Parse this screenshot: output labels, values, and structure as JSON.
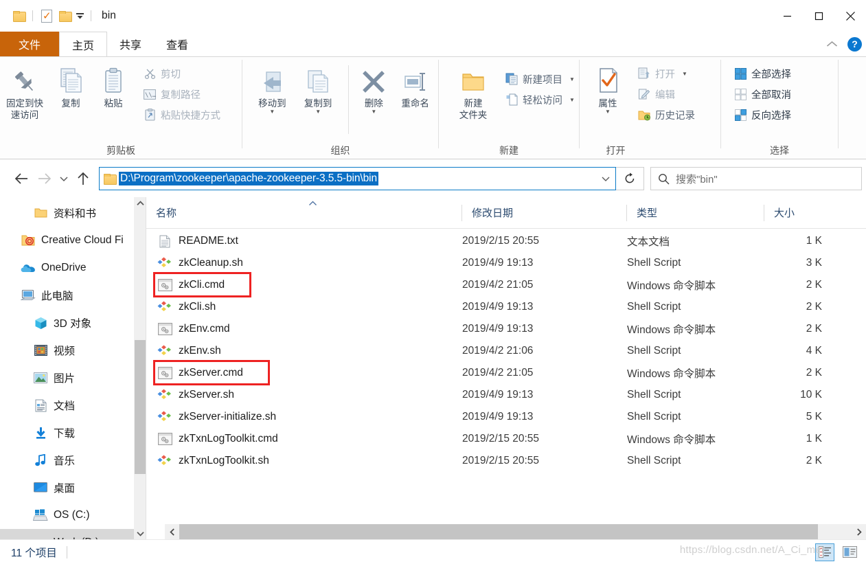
{
  "window": {
    "title": "bin",
    "quick_access": {
      "folder_icon": "folder-icon",
      "properties_icon": "properties-check-icon",
      "newfolder_icon": "new-folder-icon",
      "customize_caret": "chevron-down-icon"
    },
    "controls": {
      "minimize": "minimize-icon",
      "maximize": "maximize-icon",
      "close": "close-icon"
    }
  },
  "tabs": {
    "file": "文件",
    "items": [
      {
        "label": "主页",
        "active": true
      },
      {
        "label": "共享",
        "active": false
      },
      {
        "label": "查看",
        "active": false
      }
    ],
    "collapse_icon": "chevron-up-icon",
    "help": "?"
  },
  "ribbon": {
    "groups": [
      {
        "name": "clipboard",
        "label": "剪贴板",
        "big": [
          {
            "label": "固定到快\n速访问",
            "icon": "pin-icon"
          },
          {
            "label": "复制",
            "icon": "copy-icon"
          },
          {
            "label": "粘贴",
            "icon": "paste-icon"
          }
        ],
        "small": [
          {
            "label": "剪切",
            "icon": "scissors-icon",
            "dim": true
          },
          {
            "label": "复制路径",
            "icon": "copy-path-icon",
            "dim": true
          },
          {
            "label": "粘贴快捷方式",
            "icon": "paste-shortcut-icon",
            "dim": true
          }
        ]
      },
      {
        "name": "organize",
        "label": "组织",
        "big": [
          {
            "label": "移动到",
            "icon": "move-to-icon",
            "dropdown": true
          },
          {
            "label": "复制到",
            "icon": "copy-to-icon",
            "dropdown": true
          },
          {
            "label": "删除",
            "icon": "delete-x-icon",
            "dropdown": true
          },
          {
            "label": "重命名",
            "icon": "rename-icon"
          }
        ]
      },
      {
        "name": "new",
        "label": "新建",
        "big": [
          {
            "label": "新建\n文件夹",
            "icon": "new-folder-icon"
          }
        ],
        "small": [
          {
            "label": "新建项目",
            "icon": "new-item-icon",
            "dropdown": true
          },
          {
            "label": "轻松访问",
            "icon": "easy-access-icon",
            "dropdown": true
          }
        ]
      },
      {
        "name": "open",
        "label": "打开",
        "big": [
          {
            "label": "属性",
            "icon": "properties-check-icon",
            "dropdown": true
          }
        ],
        "small": [
          {
            "label": "打开",
            "icon": "open-icon",
            "dropdown": true,
            "dim": true
          },
          {
            "label": "编辑",
            "icon": "edit-icon",
            "dim": true
          },
          {
            "label": "历史记录",
            "icon": "history-icon"
          }
        ]
      },
      {
        "name": "select",
        "label": "选择",
        "small": [
          {
            "label": "全部选择",
            "icon": "select-all-icon"
          },
          {
            "label": "全部取消",
            "icon": "select-none-icon"
          },
          {
            "label": "反向选择",
            "icon": "invert-selection-icon"
          }
        ]
      }
    ]
  },
  "navigation": {
    "back_icon": "arrow-left-icon",
    "forward_icon": "arrow-right-icon",
    "recent_icon": "chevron-down-icon",
    "up_icon": "arrow-up-icon",
    "address": {
      "value": "D:\\Program\\zookeeper\\apache-zookeeper-3.5.5-bin\\bin",
      "folder_icon": "folder-icon",
      "dropdown_icon": "chevron-down-icon"
    },
    "refresh_icon": "refresh-icon",
    "search": {
      "placeholder": "搜索\"bin\"",
      "icon": "search-icon"
    }
  },
  "sidebar": {
    "items": [
      {
        "label": "资料和书",
        "icon": "folder-icon",
        "indent": 1,
        "selected": false
      },
      {
        "label": "Creative Cloud Fi",
        "icon": "creative-cloud-folder-icon",
        "indent": 0,
        "selected": false
      },
      {
        "label": "OneDrive",
        "icon": "onedrive-cloud-icon",
        "indent": 0,
        "selected": false
      },
      {
        "label": "此电脑",
        "icon": "this-pc-icon",
        "indent": 0,
        "selected": false
      },
      {
        "label": "3D 对象",
        "icon": "3d-objects-icon",
        "indent": 1,
        "selected": false
      },
      {
        "label": "视频",
        "icon": "videos-icon",
        "indent": 1,
        "selected": false
      },
      {
        "label": "图片",
        "icon": "pictures-icon",
        "indent": 1,
        "selected": false
      },
      {
        "label": "文档",
        "icon": "documents-icon",
        "indent": 1,
        "selected": false
      },
      {
        "label": "下载",
        "icon": "downloads-icon",
        "indent": 1,
        "selected": false
      },
      {
        "label": "音乐",
        "icon": "music-icon",
        "indent": 1,
        "selected": false
      },
      {
        "label": "桌面",
        "icon": "desktop-icon",
        "indent": 1,
        "selected": false
      },
      {
        "label": "OS (C:)",
        "icon": "windows-drive-icon",
        "indent": 1,
        "selected": false
      },
      {
        "label": "Work (D:)",
        "icon": "drive-icon",
        "indent": 1,
        "selected": true
      }
    ],
    "scroll_up_icon": "chevron-up-icon",
    "scroll_down_icon": "chevron-down-icon"
  },
  "filelist": {
    "columns": [
      {
        "label": "名称",
        "sorted": true,
        "sort_icon": "sort-ascending-icon"
      },
      {
        "label": "修改日期",
        "sorted": false
      },
      {
        "label": "类型",
        "sorted": false
      },
      {
        "label": "大小",
        "sorted": false
      }
    ],
    "rows": [
      {
        "name": "README.txt",
        "date": "2019/2/15 20:55",
        "type": "文本文档",
        "size": "1 K",
        "icon": "text-file-icon",
        "highlight": false
      },
      {
        "name": "zkCleanup.sh",
        "date": "2019/4/9 19:13",
        "type": "Shell Script",
        "size": "3 K",
        "icon": "shell-script-icon",
        "highlight": false
      },
      {
        "name": "zkCli.cmd",
        "date": "2019/4/2 21:05",
        "type": "Windows 命令脚本",
        "size": "2 K",
        "icon": "cmd-script-icon",
        "highlight": true
      },
      {
        "name": "zkCli.sh",
        "date": "2019/4/9 19:13",
        "type": "Shell Script",
        "size": "2 K",
        "icon": "shell-script-icon",
        "highlight": false
      },
      {
        "name": "zkEnv.cmd",
        "date": "2019/4/9 19:13",
        "type": "Windows 命令脚本",
        "size": "2 K",
        "icon": "cmd-script-icon",
        "highlight": false
      },
      {
        "name": "zkEnv.sh",
        "date": "2019/4/2 21:06",
        "type": "Shell Script",
        "size": "4 K",
        "icon": "shell-script-icon",
        "highlight": false
      },
      {
        "name": "zkServer.cmd",
        "date": "2019/4/2 21:05",
        "type": "Windows 命令脚本",
        "size": "2 K",
        "icon": "cmd-script-icon",
        "highlight": true
      },
      {
        "name": "zkServer.sh",
        "date": "2019/4/9 19:13",
        "type": "Shell Script",
        "size": "10 K",
        "icon": "shell-script-icon",
        "highlight": false
      },
      {
        "name": "zkServer-initialize.sh",
        "date": "2019/4/9 19:13",
        "type": "Shell Script",
        "size": "5 K",
        "icon": "shell-script-icon",
        "highlight": false
      },
      {
        "name": "zkTxnLogToolkit.cmd",
        "date": "2019/2/15 20:55",
        "type": "Windows 命令脚本",
        "size": "1 K",
        "icon": "cmd-script-icon",
        "highlight": false
      },
      {
        "name": "zkTxnLogToolkit.sh",
        "date": "2019/2/15 20:55",
        "type": "Shell Script",
        "size": "2 K",
        "icon": "shell-script-icon",
        "highlight": false
      }
    ],
    "hscroll": {
      "left_icon": "chevron-left-icon",
      "right_icon": "chevron-right-icon"
    }
  },
  "statusbar": {
    "item_count": "11 个项目",
    "details_view_icon": "details-view-icon",
    "large-icons_view_icon": "large-icons-view-icon"
  },
  "watermark": "https://blog.csdn.net/A_Ci_mer",
  "colors": {
    "accent_orange": "#c8640a",
    "selection_blue": "#0b6fc4",
    "highlight_red": "#ee2222",
    "link_blue": "#0b78d0"
  }
}
